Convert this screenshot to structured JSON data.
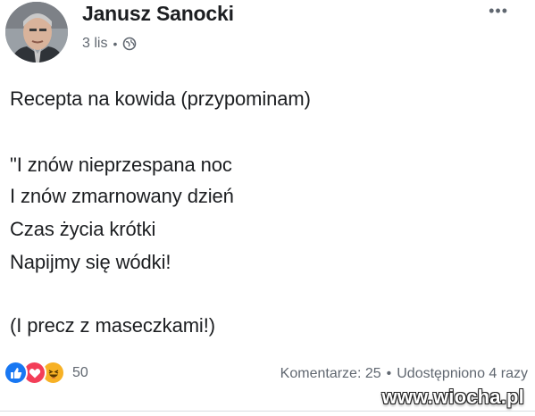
{
  "post": {
    "author": "Janusz Sanocki",
    "time": "3 lis",
    "separator": "•",
    "privacy_icon": "globe-icon",
    "more_icon": "ellipsis-icon",
    "lines": {
      "l1": "Recepta na kowida (przypominam)",
      "l2": "\"I znów nieprzespana noc",
      "l3": "I znów zmarnowany dzień",
      "l4": "Czas życia krótki",
      "l5": "Napijmy się wódki!",
      "l6": "(I precz z maseczkami!)"
    },
    "reactions": {
      "types": [
        "like-icon",
        "love-icon",
        "haha-icon"
      ],
      "count": "50"
    },
    "stats": {
      "comments": "Komentarze: 25",
      "dot": "•",
      "shares": "Udostępniono 4 razy"
    }
  },
  "watermark": "www.wiocha.pl",
  "colors": {
    "like": "#1877f2",
    "love": "#f33e58",
    "haha": "#f7b125",
    "secondary_text": "#606770"
  }
}
